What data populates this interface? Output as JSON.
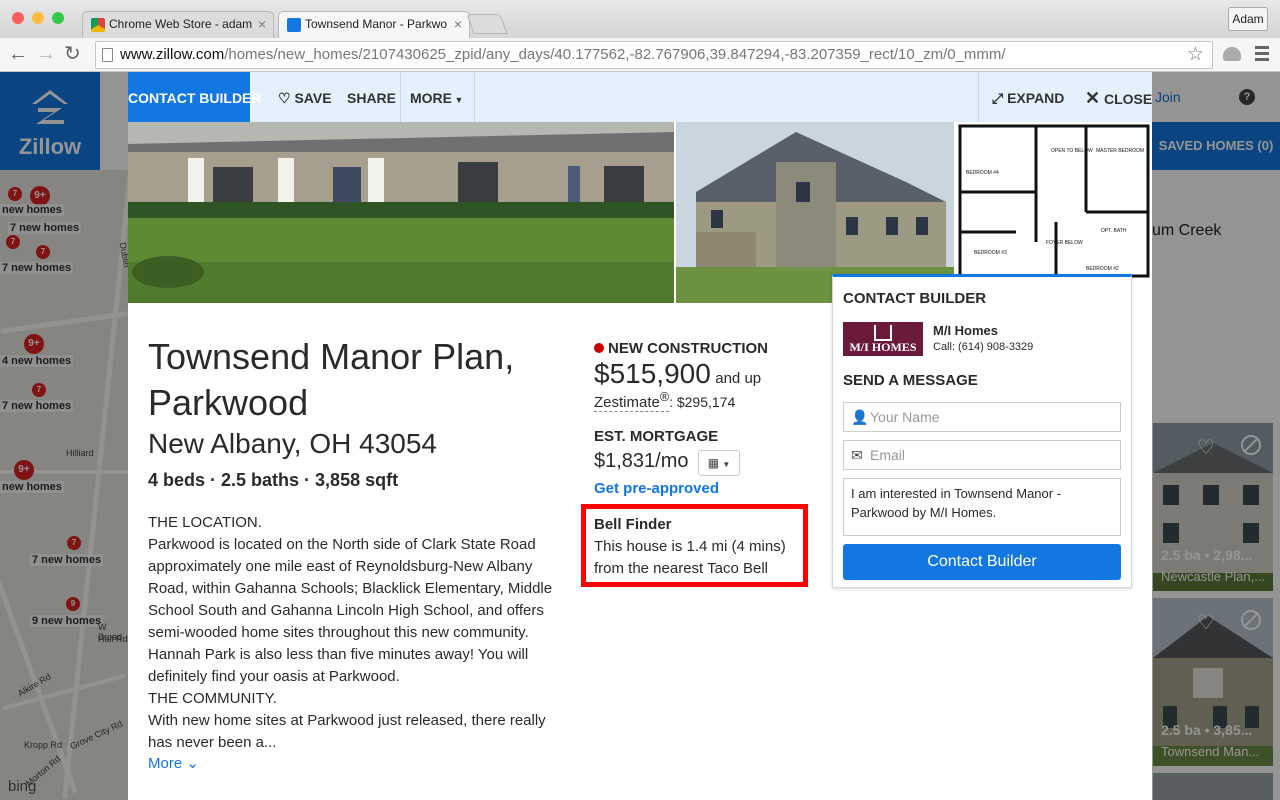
{
  "browser": {
    "tabs": [
      {
        "title": "Chrome Web Store - adam",
        "favicon": "chrome-web-store-icon"
      },
      {
        "title": "Townsend Manor - Parkwo",
        "favicon": "zillow-icon"
      }
    ],
    "profile_name": "Adam",
    "url_host": "www.zillow.com",
    "url_path": "/homes/new_homes/2107430625_zpid/any_days/40.177562,-82.767906,39.847294,-83.207359_rect/10_zm/0_mmm/"
  },
  "zillow": {
    "logo_text": "Zillow",
    "join_label": "Join",
    "help_label": "?",
    "saved_homes_label": "SAVED HOMES (0)",
    "partial_place": "um Creek",
    "map": {
      "labels": [
        "7 new homes",
        "7 new homes",
        "4 new homes",
        "7 new homes",
        "new homes",
        "7 new homes",
        "9 new homes",
        "new homes"
      ],
      "places": [
        "Dublin",
        "Hilliard",
        "W Broad",
        "Hall Rd",
        "Alkire Rd",
        "Kropp Rd",
        "Grove City Rd",
        "Morton Rd"
      ],
      "pins": [
        "7",
        "9+",
        "7",
        "7",
        "9+",
        "7",
        "9+",
        "7",
        "9"
      ],
      "attribution": "bing"
    },
    "side_cards": [
      {
        "meta": "2.5 ba • 2,98...",
        "name": "Newcastle Plan,..."
      },
      {
        "meta": "2.5 ba • 3,85...",
        "name": "Townsend Man..."
      }
    ]
  },
  "modal": {
    "toolbar": {
      "contact_builder": "CONTACT BUILDER",
      "save": "SAVE",
      "share": "SHARE",
      "more": "MORE",
      "expand": "EXPAND",
      "close": "CLOSE"
    },
    "title": "Townsend Manor Plan, Parkwood",
    "address": "New Albany, OH 43054",
    "specs": "4 beds · 2.5 baths · 3,858 sqft",
    "description": [
      "THE LOCATION.",
      "Parkwood is located on the North side of Clark State Road approximately one mile east of Reynoldsburg-New Albany Road, within Gahanna Schools; Blacklick Elementary, Middle School South and Gahanna Lincoln High School, and offers semi-wooded home sites throughout this new community. Hannah Park is also less than five minutes away! You will definitely find your oasis at Parkwood.",
      "THE COMMUNITY.",
      "With new home sites at Parkwood just released, there really has never been a..."
    ],
    "more_link": "More",
    "status": "NEW CONSTRUCTION",
    "status_color": "#cc0000",
    "price": "$515,900",
    "price_suffix": "and up",
    "zestimate_label": "Zestimate",
    "zestimate_value": ": $295,174",
    "mortgage_label": "EST. MORTGAGE",
    "mortgage_value": "$1,831/mo",
    "preapproved_link": "Get pre-approved",
    "bell_finder": {
      "title": "Bell Finder",
      "text": "This house is 1.4 mi (4 mins) from the nearest Taco Bell",
      "border_color": "#ff0000"
    },
    "contact_box": {
      "heading": "CONTACT BUILDER",
      "builder_logo_text": "M/I HOMES",
      "builder_name": "M/I Homes",
      "builder_phone": "Call: (614) 908-3329",
      "send_heading": "SEND A MESSAGE",
      "name_placeholder": "Your Name",
      "email_placeholder": "Email",
      "message": "I am interested in Townsend Manor - Parkwood by M/I Homes.",
      "button_label": "Contact Builder"
    },
    "floorplan_labels": [
      "BEDROOM #4",
      "MASTER BEDROOM",
      "BEDROOM #3",
      "BEDROOM #2",
      "OPEN TO BELOW",
      "OPT. BATH",
      "FOYER BELOW"
    ]
  },
  "colors": {
    "accent": "#1277e1",
    "highlight": "#ff0000"
  }
}
